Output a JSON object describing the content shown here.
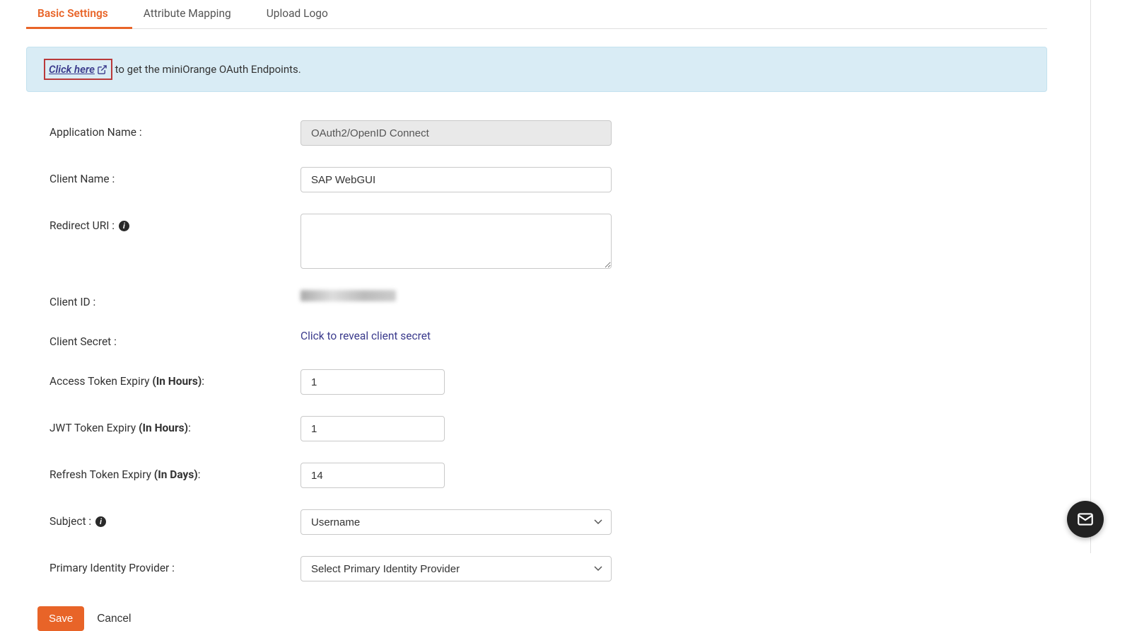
{
  "tabs": {
    "basic_settings": "Basic Settings",
    "attribute_mapping": "Attribute Mapping",
    "upload_logo": "Upload Logo"
  },
  "banner": {
    "link_text": "Click here",
    "suffix_text": " to get the miniOrange OAuth Endpoints."
  },
  "form": {
    "application_name": {
      "label": "Application Name :",
      "value": "OAuth2/OpenID Connect"
    },
    "client_name": {
      "label": "Client Name :",
      "value": "SAP WebGUI"
    },
    "redirect_uri": {
      "label": "Redirect URI :",
      "value": ""
    },
    "client_id": {
      "label": "Client ID :",
      "value": ""
    },
    "client_secret": {
      "label": "Client Secret :",
      "reveal_text": "Click to reveal client secret"
    },
    "access_token_expiry": {
      "label_prefix": "Access Token Expiry ",
      "label_bold": "(In Hours)",
      "label_suffix": ":",
      "value": "1"
    },
    "jwt_token_expiry": {
      "label_prefix": "JWT Token Expiry ",
      "label_bold": "(In Hours)",
      "label_suffix": ":",
      "value": "1"
    },
    "refresh_token_expiry": {
      "label_prefix": "Refresh Token Expiry ",
      "label_bold": "(In Days)",
      "label_suffix": ":",
      "value": "14"
    },
    "subject": {
      "label": "Subject :",
      "value": "Username"
    },
    "primary_idp": {
      "label": "Primary Identity Provider :",
      "value": "Select Primary Identity Provider"
    }
  },
  "buttons": {
    "save": "Save",
    "cancel": "Cancel"
  }
}
